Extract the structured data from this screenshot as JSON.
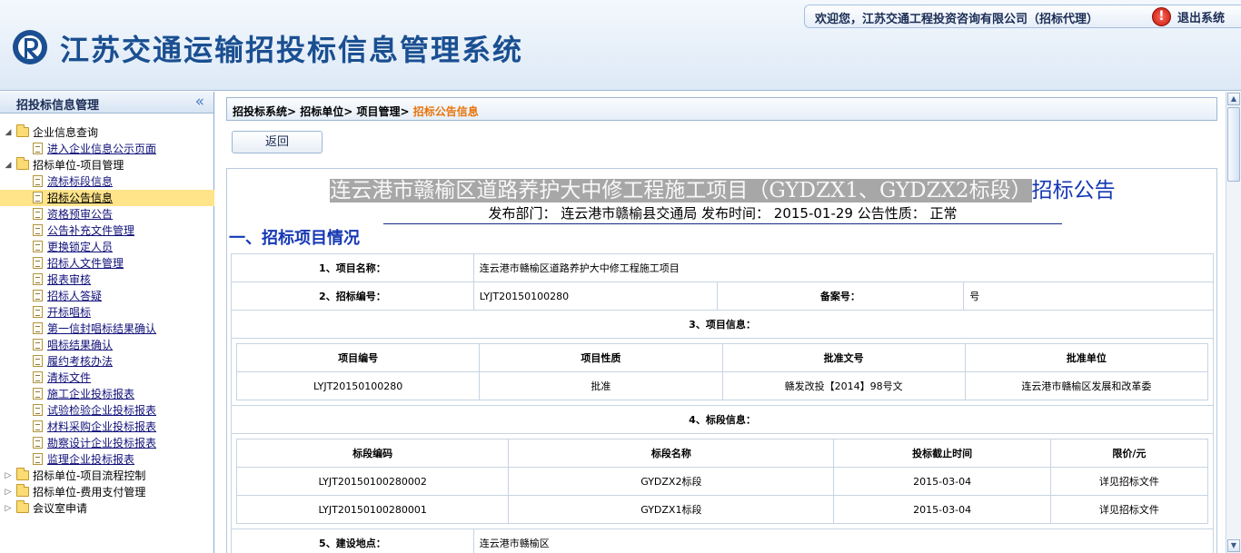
{
  "header": {
    "app_title": "江苏交通运输招投标信息管理系统",
    "welcome": "欢迎您，江苏交通工程投资咨询有限公司（招标代理）",
    "logout_label": "退出系统"
  },
  "sidebar": {
    "title": "招投标信息管理",
    "collapse_glyph": "«",
    "tree": [
      {
        "label": "企业信息查询",
        "type": "folder",
        "level": 0,
        "expanded": true
      },
      {
        "label": "进入企业信息公示页面",
        "type": "doc",
        "level": 1
      },
      {
        "label": "招标单位-项目管理",
        "type": "folder",
        "level": 0,
        "expanded": true
      },
      {
        "label": "流标标段信息",
        "type": "doc",
        "level": 1
      },
      {
        "label": "招标公告信息",
        "type": "doc",
        "level": 1,
        "selected": true
      },
      {
        "label": "资格预审公告",
        "type": "doc",
        "level": 1
      },
      {
        "label": "公告补充文件管理",
        "type": "doc",
        "level": 1
      },
      {
        "label": "更换锁定人员",
        "type": "doc",
        "level": 1
      },
      {
        "label": "招标人文件管理",
        "type": "doc",
        "level": 1
      },
      {
        "label": "报表审核",
        "type": "doc",
        "level": 1
      },
      {
        "label": "招标人答疑",
        "type": "doc",
        "level": 1
      },
      {
        "label": "开标唱标",
        "type": "doc",
        "level": 1
      },
      {
        "label": "第一信封唱标结果确认",
        "type": "doc",
        "level": 1
      },
      {
        "label": "唱标结果确认",
        "type": "doc",
        "level": 1
      },
      {
        "label": "履约考核办法",
        "type": "doc",
        "level": 1
      },
      {
        "label": "清标文件",
        "type": "doc",
        "level": 1
      },
      {
        "label": "施工企业投标报表",
        "type": "doc",
        "level": 1
      },
      {
        "label": "试验检验企业投标报表",
        "type": "doc",
        "level": 1
      },
      {
        "label": "材料采购企业投标报表",
        "type": "doc",
        "level": 1
      },
      {
        "label": "勘察设计企业投标报表",
        "type": "doc",
        "level": 1
      },
      {
        "label": "监理企业投标报表",
        "type": "doc",
        "level": 1
      },
      {
        "label": "招标单位-项目流程控制",
        "type": "folder",
        "level": 0,
        "expanded": false
      },
      {
        "label": "招标单位-费用支付管理",
        "type": "folder",
        "level": 0,
        "expanded": false
      },
      {
        "label": "会议室申请",
        "type": "folder",
        "level": 0,
        "expanded": false
      }
    ]
  },
  "breadcrumb": {
    "items": [
      "招投标系统>",
      "招标单位>",
      "项目管理>"
    ],
    "current": "招标公告信息"
  },
  "back_button": "返回",
  "announcement": {
    "title_highlight": "连云港市赣榆区道路养护大中修工程施工项目（GYDZX1、GYDZX2标段）",
    "title_suffix": "招标公告",
    "meta": "发布部门： 连云港市赣榆县交通局 发布时间： 2015-01-29 公告性质： 正常",
    "section_heading": "一、招标项目情况"
  },
  "project": {
    "name_label": "1、项目名称：",
    "name_value": "连云港市赣榆区道路养护大中修工程施工项目",
    "code_label": "2、招标编号：",
    "code_value": "LYJT20150100280",
    "record_label": "备案号：",
    "record_value": "号",
    "info_heading": "3、项目信息：",
    "info_headers": [
      "项目编号",
      "项目性质",
      "批准文号",
      "批准单位"
    ],
    "info_row": [
      "LYJT20150100280",
      "批准",
      "赣发改投【2014】98号文",
      "连云港市赣榆区发展和改革委"
    ],
    "sections_heading": "4、标段信息：",
    "sections_headers": [
      "标段编码",
      "标段名称",
      "投标截止时间",
      "限价/元"
    ],
    "sections_rows": [
      [
        "LYJT20150100280002",
        "GYDZX2标段",
        "2015-03-04",
        "详见招标文件"
      ],
      [
        "LYJT20150100280001",
        "GYDZX1标段",
        "2015-03-04",
        "详见招标文件"
      ]
    ],
    "location_label": "5、建设地点：",
    "location_value": "连云港市赣榆区"
  },
  "scrollbar": {
    "up_glyph": "▲",
    "down_glyph": "▼"
  },
  "colors": {
    "title_blue": "#1537b3",
    "app_title": "#1a4f91",
    "breadcrumb_current": "#e8740c",
    "selected_bg": "#ffe48a"
  }
}
